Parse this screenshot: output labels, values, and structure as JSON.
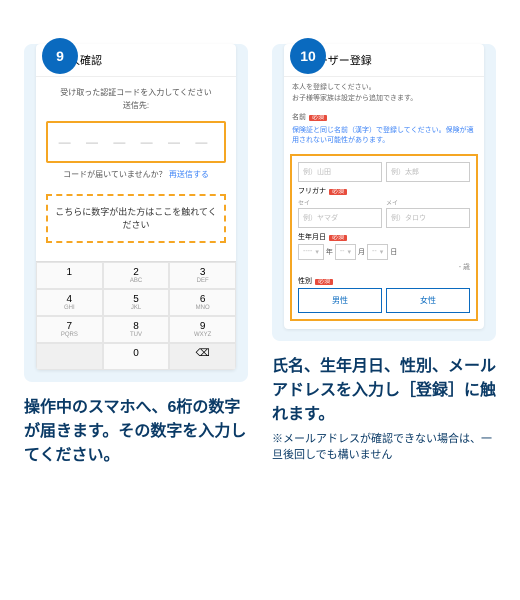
{
  "steps": {
    "s9": {
      "num": "9",
      "headline": "操作中のスマホへ、6桁の数字が届きます。その数字を入力してください。"
    },
    "s10": {
      "num": "10",
      "headline": "氏名、生年月日、性別、メールアドレスを入力し［登録］に触れます。",
      "sub": "※メールアドレスが確認できない場合は、一旦後回しでも構いません"
    }
  },
  "p9": {
    "title": "本人確認",
    "note1": "受け取った認証コードを入力してください",
    "note2": "送信先:",
    "dashes": "— — — — — —",
    "resend_q": "コードが届いていませんか？",
    "resend_a": "再送信する",
    "hint": "こちらに数字が出た方はここを触れてください",
    "keys": {
      "k1": "1",
      "k2": "2",
      "k3": "3",
      "k4": "4",
      "k5": "5",
      "k6": "6",
      "k7": "7",
      "k8": "8",
      "k9": "9",
      "k0": "0",
      "s2": "ABC",
      "s3": "DEF",
      "s4": "GHI",
      "s5": "JKL",
      "s6": "MNO",
      "s7": "PQRS",
      "s8": "TUV",
      "s9": "WXYZ",
      "del": "⌫"
    }
  },
  "p10": {
    "title": "ユーザー登録",
    "intro1": "本人を登録してください。",
    "intro2": "お子様等家族は設定から追加できます。",
    "name_lbl": "名前",
    "warn": "保険証と同じ名前（漢字）で登録してください。保険が適用されない可能性があります。",
    "ph_last": "例）山田",
    "ph_first": "例）太郎",
    "kana_lbl": "フリガナ",
    "last_small": "セイ",
    "first_small": "メイ",
    "ph_klast": "例）ヤマダ",
    "ph_kfirst": "例）タロウ",
    "dob_lbl": "生年月日",
    "y": "----",
    "m": "--",
    "d": "--",
    "ys": "年",
    "ms": "月",
    "ds": "日",
    "age": "- 歳",
    "sex_lbl": "性別",
    "male": "男性",
    "female": "女性",
    "req": "必須"
  }
}
